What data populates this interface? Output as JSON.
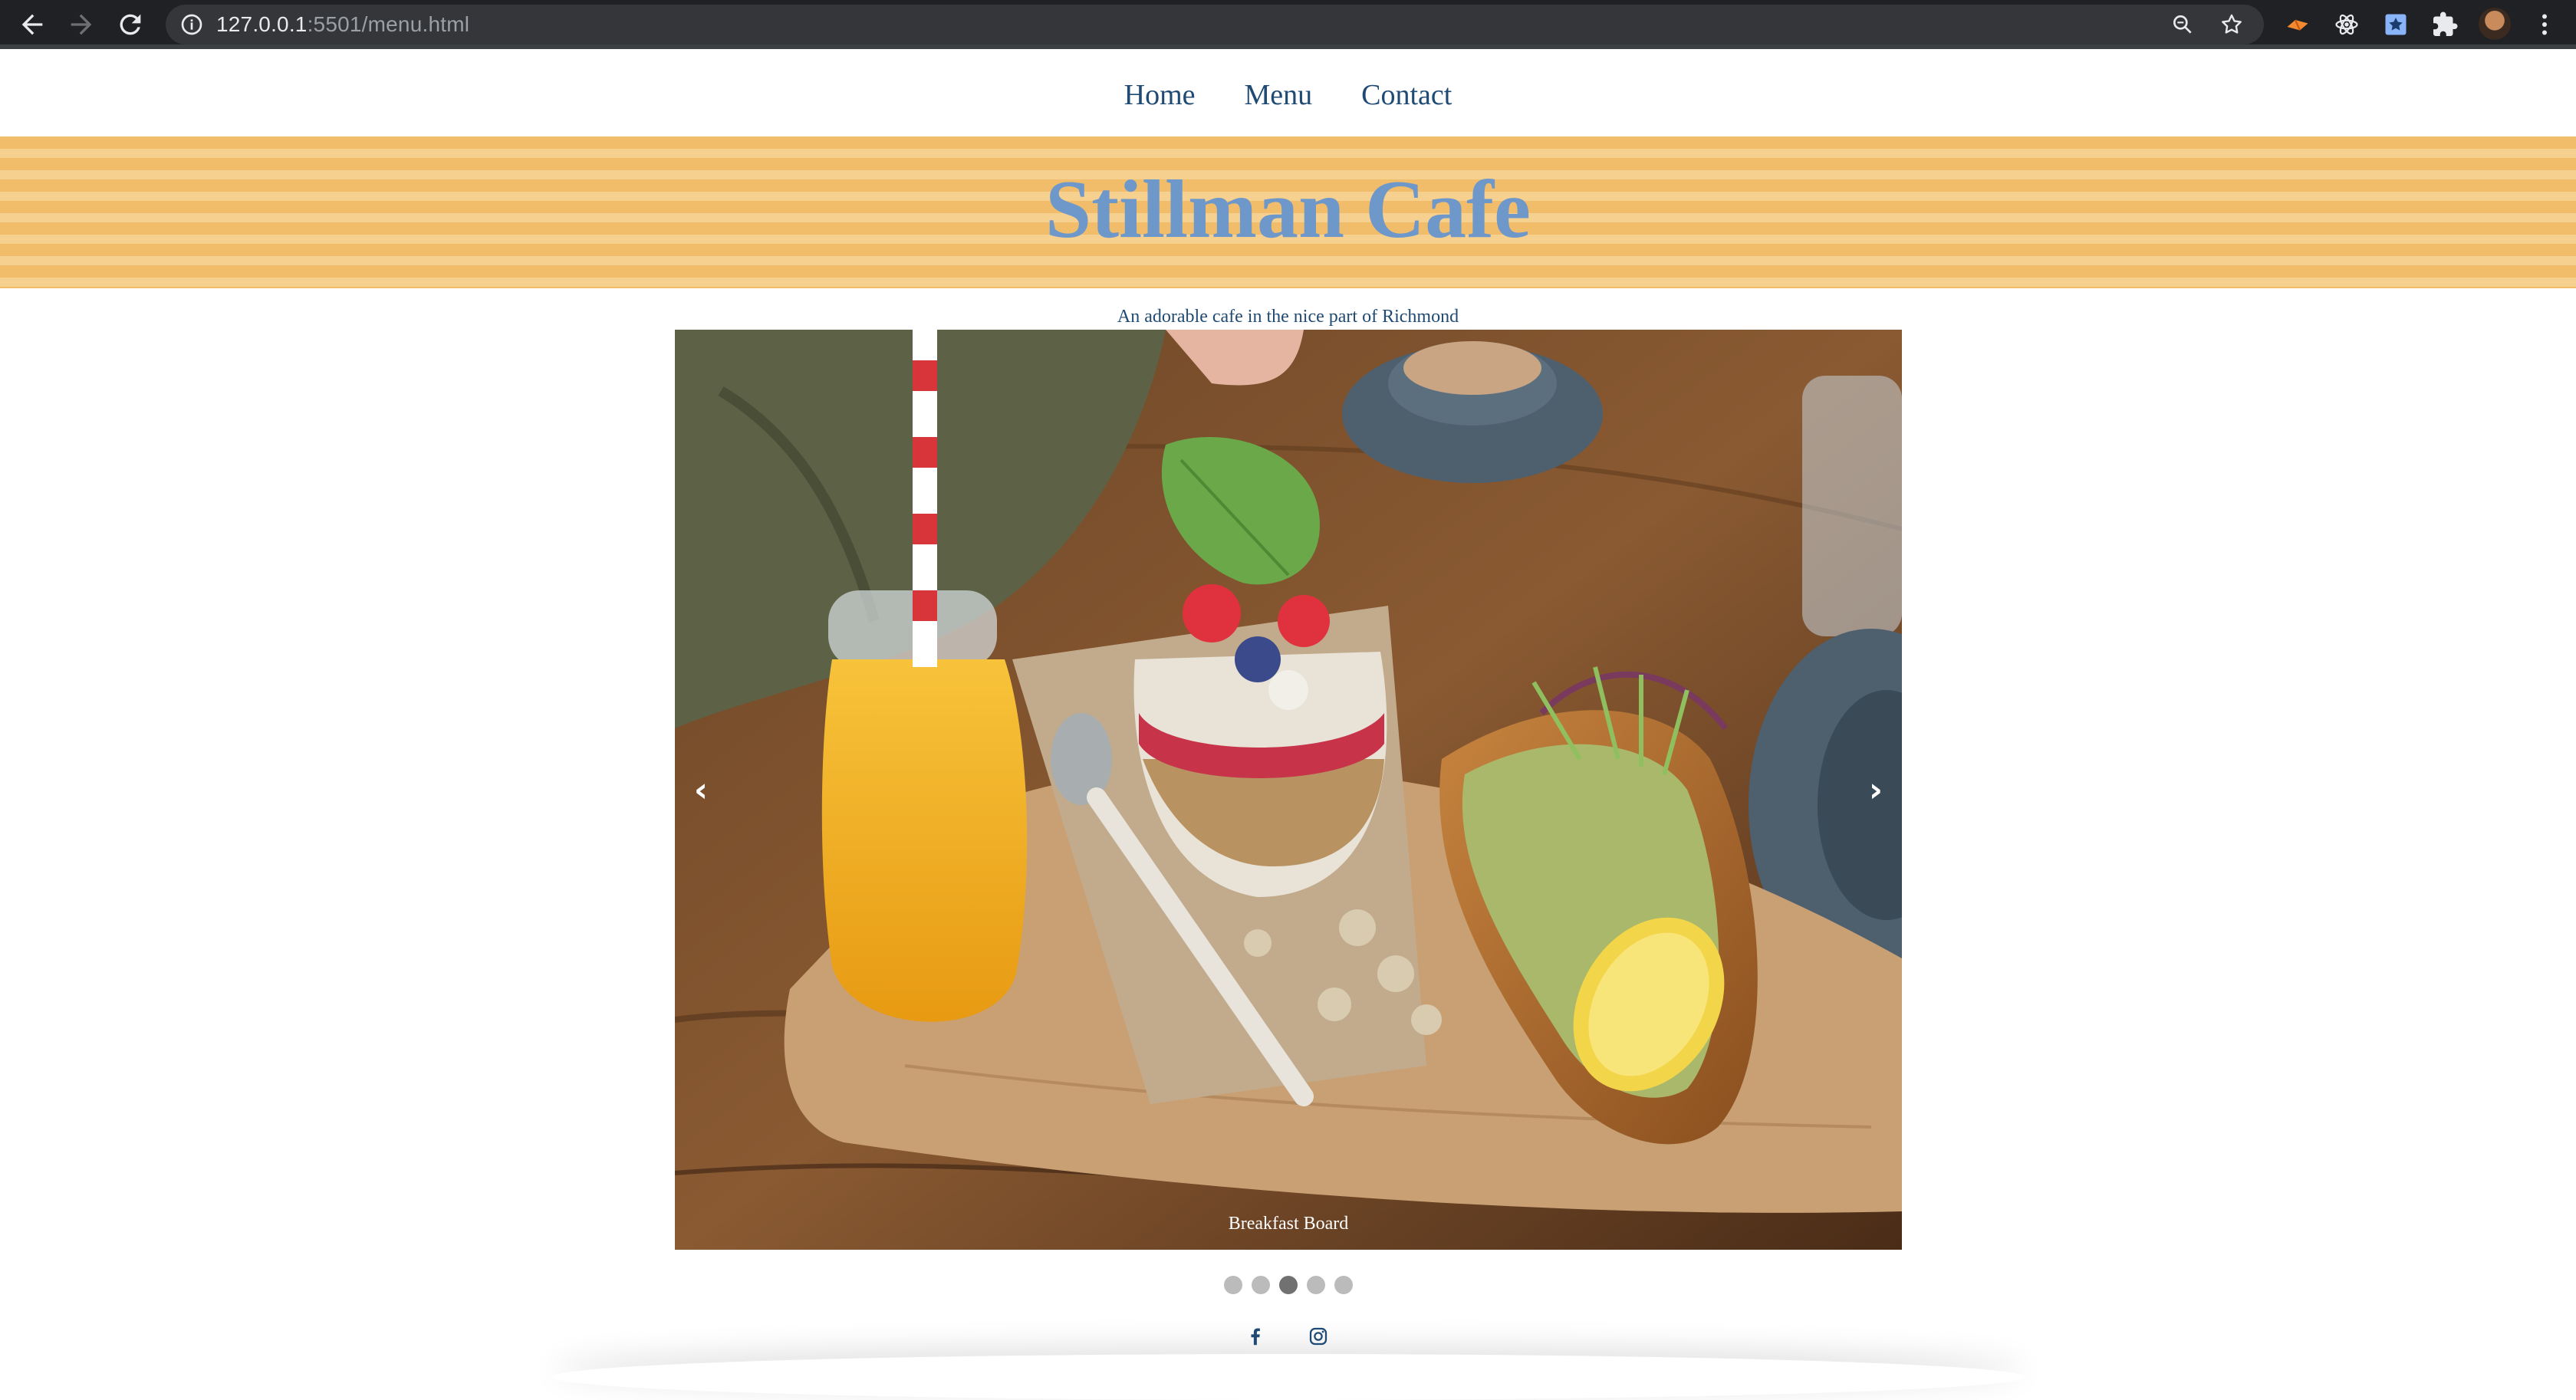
{
  "browser": {
    "url_host": "127.0.0.1",
    "url_rest": ":5501/menu.html",
    "icons": [
      "back-arrow-icon",
      "forward-arrow-icon",
      "reload-icon",
      "info-icon",
      "zoom-icon",
      "bookmark-star-icon",
      "extension-icon",
      "react-devtools-icon",
      "bookmark-extension-icon",
      "puzzle-icon",
      "avatar",
      "menu-kebab-icon"
    ]
  },
  "nav": {
    "links": [
      "Home",
      "Menu",
      "Contact"
    ]
  },
  "header": {
    "title": "Stillman Cafe",
    "tagline": "An adorable cafe in the nice part of Richmond"
  },
  "slideshow": {
    "caption": "Breakfast Board",
    "prev_label": "‹",
    "next_label": "›",
    "slide_count": 5,
    "active_index": 2
  },
  "footer": {
    "social": [
      "facebook-icon",
      "instagram-icon"
    ]
  },
  "colors": {
    "title": "#6e98c9",
    "link": "#1e4a73",
    "stripe_dark": "#f2bd6a",
    "stripe_light": "#f6d08f"
  }
}
